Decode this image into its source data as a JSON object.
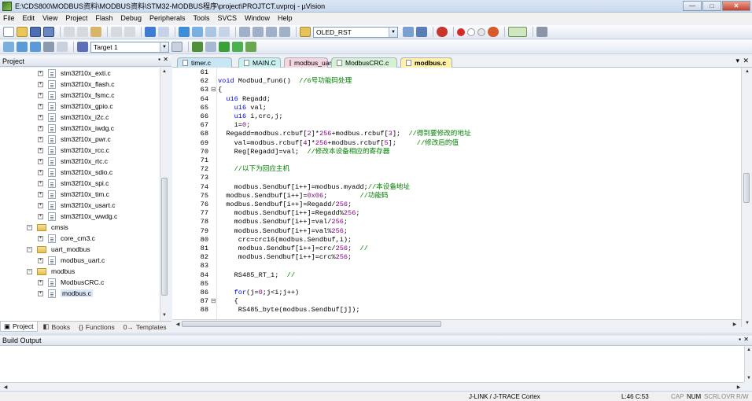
{
  "window": {
    "title": "E:\\CDS800\\MODBUS资料\\MODBUS资料\\STM32-MODBUS程序\\project\\PROJTCT.uvproj - µVision",
    "minimize": "—",
    "maximize": "□",
    "close": "✕"
  },
  "menu": [
    "File",
    "Edit",
    "View",
    "Project",
    "Flash",
    "Debug",
    "Peripherals",
    "Tools",
    "SVCS",
    "Window",
    "Help"
  ],
  "toolbar": {
    "find_combo_value": "OLED_RST",
    "target_combo_value": "Target 1"
  },
  "project_pane": {
    "title": "Project",
    "pin": "▪",
    "close": "✕",
    "items": [
      {
        "label": "stm32f10x_exti.c",
        "type": "file",
        "level": 2
      },
      {
        "label": "stm32f10x_flash.c",
        "type": "file",
        "level": 2
      },
      {
        "label": "stm32f10x_fsmc.c",
        "type": "file",
        "level": 2
      },
      {
        "label": "stm32f10x_gpio.c",
        "type": "file",
        "level": 2
      },
      {
        "label": "stm32f10x_i2c.c",
        "type": "file",
        "level": 2
      },
      {
        "label": "stm32f10x_iwdg.c",
        "type": "file",
        "level": 2
      },
      {
        "label": "stm32f10x_pwr.c",
        "type": "file",
        "level": 2
      },
      {
        "label": "stm32f10x_rcc.c",
        "type": "file",
        "level": 2
      },
      {
        "label": "stm32f10x_rtc.c",
        "type": "file",
        "level": 2
      },
      {
        "label": "stm32f10x_sdio.c",
        "type": "file",
        "level": 2
      },
      {
        "label": "stm32f10x_spi.c",
        "type": "file",
        "level": 2
      },
      {
        "label": "stm32f10x_tim.c",
        "type": "file",
        "level": 2
      },
      {
        "label": "stm32f10x_usart.c",
        "type": "file",
        "level": 2
      },
      {
        "label": "stm32f10x_wwdg.c",
        "type": "file",
        "level": 2
      },
      {
        "label": "cmsis",
        "type": "folder",
        "level": 1
      },
      {
        "label": "core_cm3.c",
        "type": "file",
        "level": 2
      },
      {
        "label": "uart_modbus",
        "type": "folder",
        "level": 1
      },
      {
        "label": "modbus_uart.c",
        "type": "file",
        "level": 2
      },
      {
        "label": "modbus",
        "type": "folder",
        "level": 1
      },
      {
        "label": "ModbusCRC.c",
        "type": "file",
        "level": 2
      },
      {
        "label": "modbus.c",
        "type": "file",
        "level": 2,
        "selected": true
      }
    ],
    "tabs": [
      {
        "label": "Project",
        "icon": "▣"
      },
      {
        "label": "Books",
        "icon": "◧"
      },
      {
        "label": "Functions",
        "icon": "{}"
      },
      {
        "label": "Templates",
        "icon": "0→"
      }
    ]
  },
  "editor": {
    "tabs": [
      {
        "label": "timer.c",
        "color": "#c9e6f5"
      },
      {
        "label": "MAIN.C",
        "color": "#c9f0f0"
      },
      {
        "label": "modbus_uart.c",
        "color": "#f5d5e0"
      },
      {
        "label": "ModbusCRC.c",
        "color": "#d5f0d5"
      },
      {
        "label": "modbus.c",
        "color": "#fff2a8",
        "active": true
      }
    ],
    "tab_chevron": "▾",
    "tab_close": "✕",
    "lines": [
      {
        "n": "61",
        "fold": "",
        "code": ""
      },
      {
        "n": "62",
        "fold": "",
        "code": "void Modbud_fun6()  //6号功能码处理"
      },
      {
        "n": "63",
        "fold": "⊟",
        "code": "{"
      },
      {
        "n": "64",
        "fold": "",
        "code": "  u16 Regadd;"
      },
      {
        "n": "65",
        "fold": "",
        "code": "    u16 val;"
      },
      {
        "n": "66",
        "fold": "",
        "code": "    u16 i,crc,j;"
      },
      {
        "n": "67",
        "fold": "",
        "code": "    i=0;"
      },
      {
        "n": "68",
        "fold": "",
        "code": "  Regadd=modbus.rcbuf[2]*256+modbus.rcbuf[3];  //得到要修改的地址"
      },
      {
        "n": "69",
        "fold": "",
        "code": "    val=modbus.rcbuf[4]*256+modbus.rcbuf[5];     //修改后的值"
      },
      {
        "n": "70",
        "fold": "",
        "code": "    Reg[Regadd]=val;  //修改本设备相应的寄存器"
      },
      {
        "n": "71",
        "fold": "",
        "code": ""
      },
      {
        "n": "72",
        "fold": "",
        "code": "    //以下为回应主机"
      },
      {
        "n": "73",
        "fold": "",
        "code": ""
      },
      {
        "n": "74",
        "fold": "",
        "code": "    modbus.Sendbuf[i++]=modbus.myadd;//本设备地址"
      },
      {
        "n": "75",
        "fold": "",
        "code": "  modbus.Sendbuf[i++]=0x06;        //功能码"
      },
      {
        "n": "76",
        "fold": "",
        "code": "  modbus.Sendbuf[i++]=Regadd/256;"
      },
      {
        "n": "77",
        "fold": "",
        "code": "    modbus.Sendbuf[i++]=Regadd%256;"
      },
      {
        "n": "78",
        "fold": "",
        "code": "    modbus.Sendbuf[i++]=val/256;"
      },
      {
        "n": "79",
        "fold": "",
        "code": "    modbus.Sendbuf[i++]=val%256;"
      },
      {
        "n": "80",
        "fold": "",
        "code": "     crc=crc16(modbus.Sendbuf,i);"
      },
      {
        "n": "81",
        "fold": "",
        "code": "     modbus.Sendbuf[i++]=crc/256;  //"
      },
      {
        "n": "82",
        "fold": "",
        "code": "     modbus.Sendbuf[i++]=crc%256;"
      },
      {
        "n": "83",
        "fold": "",
        "code": ""
      },
      {
        "n": "84",
        "fold": "",
        "code": "    RS485_RT_1;  //"
      },
      {
        "n": "85",
        "fold": "",
        "code": ""
      },
      {
        "n": "86",
        "fold": "",
        "code": "    for(j=0;j<i;j++)"
      },
      {
        "n": "87",
        "fold": "⊟",
        "code": "    {"
      },
      {
        "n": "88",
        "fold": "",
        "code": "     RS485_byte(modbus.Sendbuf[j]);"
      }
    ]
  },
  "build_output": {
    "title": "Build Output",
    "pin": "▪",
    "close": "✕"
  },
  "statusbar": {
    "debugger": "J-LINK / J-TRACE Cortex",
    "position": "L:46 C:53",
    "cap": "CAP",
    "num": "NUM",
    "scrl": "SCRL",
    "ovr": "OVR",
    "rw": "R/W"
  },
  "colors": {
    "keyword": "#0000ff",
    "comment": "#008000",
    "number": "#800080"
  }
}
